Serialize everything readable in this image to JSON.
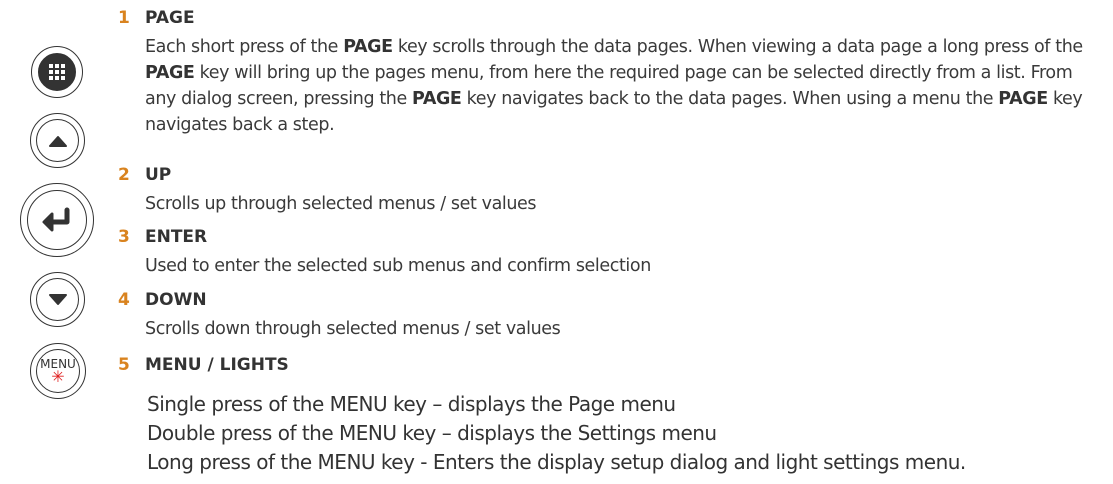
{
  "keys": [
    {
      "name": "page-key",
      "icon": "grid-icon"
    },
    {
      "name": "up-key",
      "icon": "triangle-up-icon"
    },
    {
      "name": "enter-key",
      "icon": "enter-arrow-icon"
    },
    {
      "name": "down-key",
      "icon": "triangle-down-icon"
    },
    {
      "name": "menu-key",
      "label": "MENU",
      "icon": "sun-icon",
      "icon_color": "#e02020"
    }
  ],
  "colors": {
    "number": "#d9831f",
    "text": "#333333"
  },
  "items": [
    {
      "number": "1",
      "title": "PAGE",
      "desc": [
        "Each short press of the ",
        {
          "b": "PAGE"
        },
        " key scrolls through the data pages. When viewing a data page a long press of the ",
        {
          "b": "PAGE"
        },
        " key will bring up the pages menu, from here the required page can be selected directly from a list. From any dialog screen, pressing the ",
        {
          "b": "PAGE"
        },
        " key navigates back to the data pages. When using a menu the ",
        {
          "b": "PAGE"
        },
        " key navigates back a step."
      ]
    },
    {
      "number": "2",
      "title": "UP",
      "desc_text": "Scrolls up through selected menus / set values"
    },
    {
      "number": "3",
      "title": "ENTER",
      "desc_text": "Used to enter the selected sub menus and confirm selection"
    },
    {
      "number": "4",
      "title": "DOWN",
      "desc_text": "Scrolls down through selected menus / set values"
    },
    {
      "number": "5",
      "title": "MENU / LIGHTS",
      "lines": [
        "Single press of the MENU key – displays the Page menu",
        "Double press of the MENU key – displays the Settings menu",
        "Long press of the MENU key - Enters the display setup dialog and light settings menu."
      ]
    }
  ]
}
